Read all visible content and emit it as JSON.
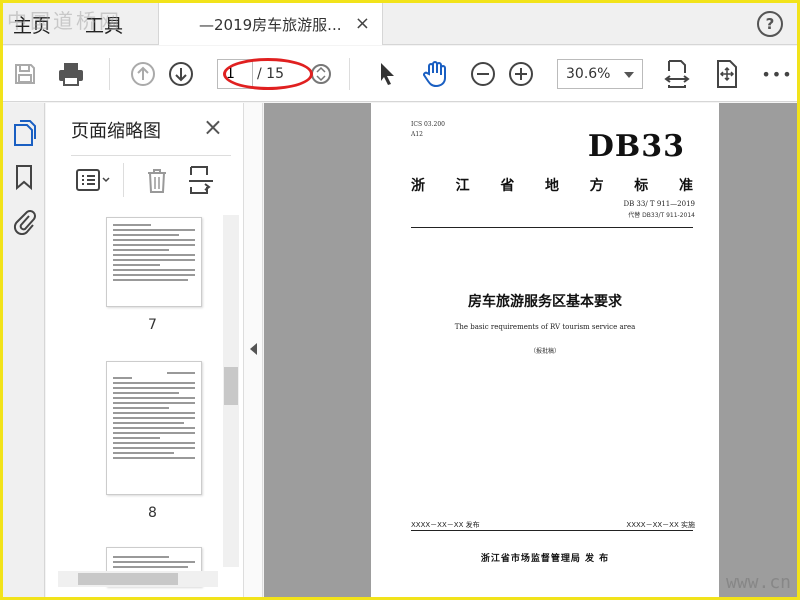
{
  "watermark": {
    "text": "中国道桥网",
    "url": "www.cn"
  },
  "tabs": {
    "home": "主页",
    "tools": "工具",
    "document": "—2019房车旅游服...",
    "close": "×",
    "help": "?"
  },
  "toolbar": {
    "current_page": "1",
    "total_pages": "/ 15",
    "zoom": "30.6%",
    "more": "•••"
  },
  "panel": {
    "title": "页面缩略图",
    "close": "×",
    "thumbnails": [
      {
        "page": "7"
      },
      {
        "page": "8"
      }
    ]
  },
  "document": {
    "ics": "ICS 03.200",
    "classification": "A12",
    "code": "DB33",
    "standard_type": [
      "浙",
      "江",
      "省",
      "地",
      "方",
      "标",
      "准"
    ],
    "number": "DB 33/ T 911—2019",
    "replaces": "代替 DB33/T 911-2014",
    "title": "房车旅游服务区基本要求",
    "title_en": "The basic requirements of RV tourism service area",
    "draft": "（报批稿）",
    "publish_date": "XXXX－XX－XX 发布",
    "effective_date": "XXXX－XX－XX 实施",
    "issuer": "浙江省市场监督管理局  发 布"
  },
  "colors": {
    "frame": "#f2e31a",
    "annotation": "#e02020",
    "accent": "#1a5fc2"
  }
}
